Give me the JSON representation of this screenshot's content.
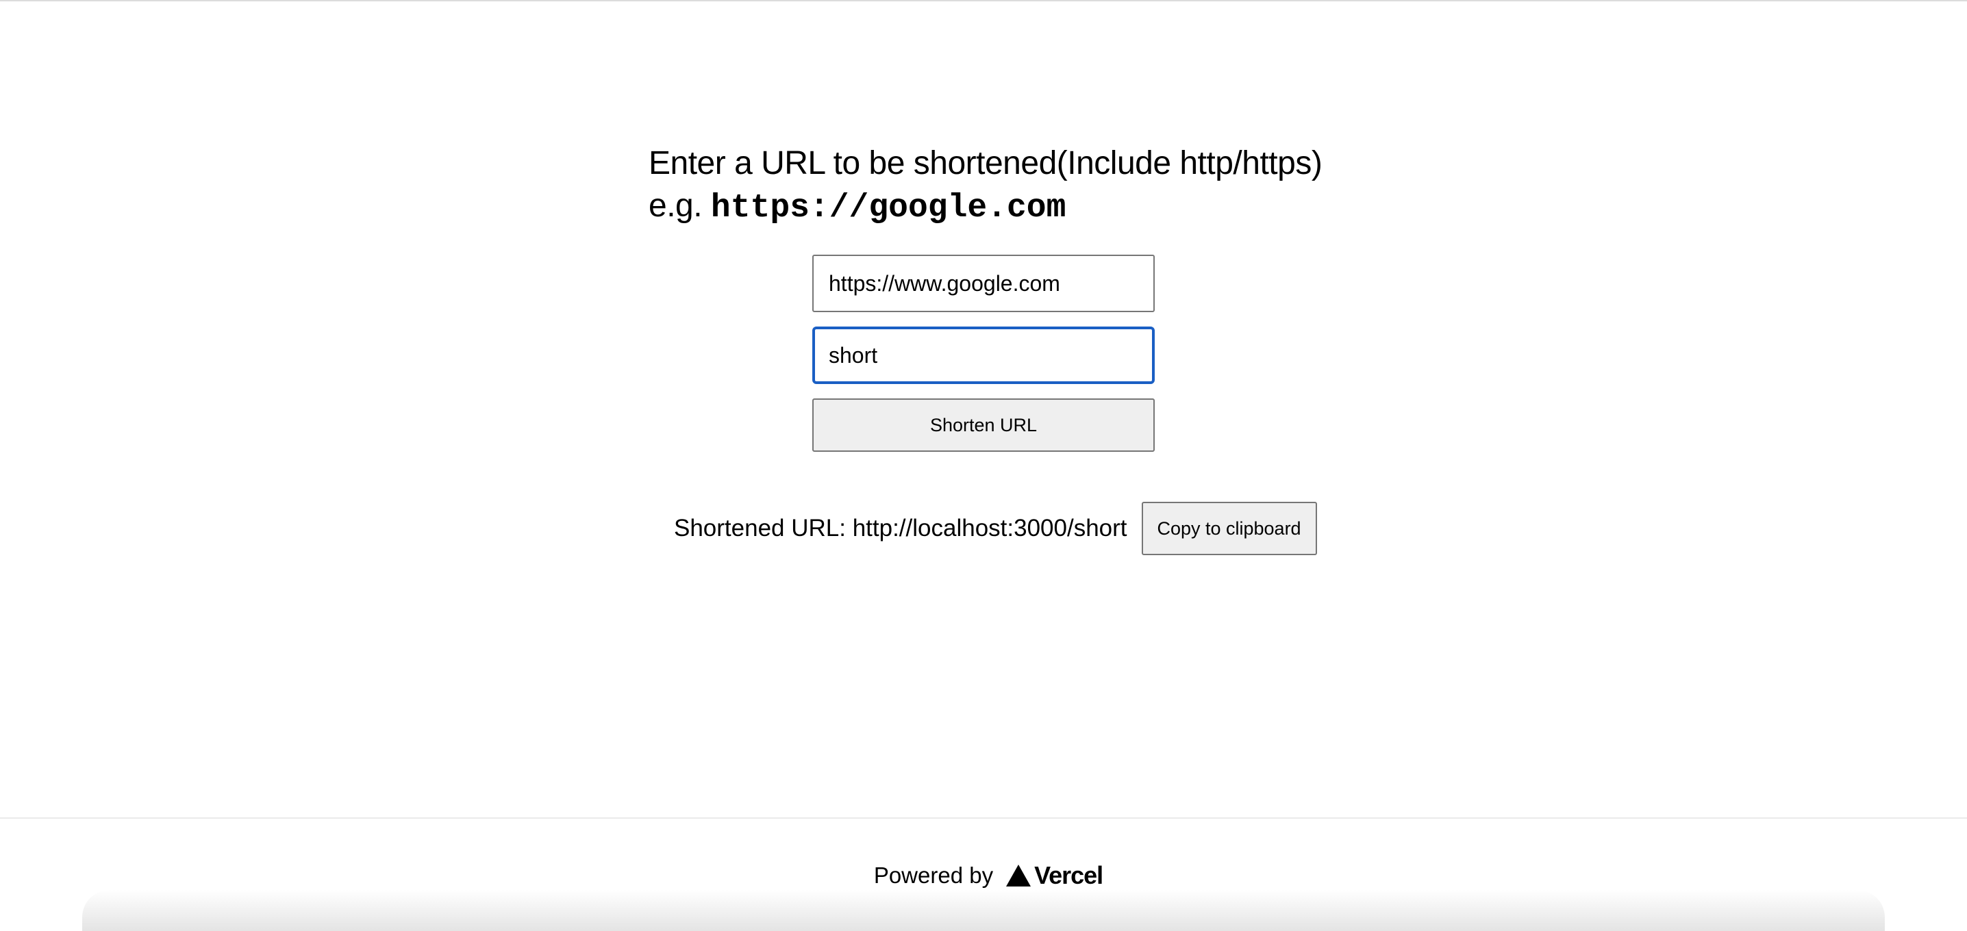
{
  "heading": {
    "line1": "Enter a URL to be shortened(Include http/https)",
    "example_prefix": "e.g. ",
    "example_url": "https://google.com"
  },
  "form": {
    "url_value": "https://www.google.com",
    "alias_value": "short",
    "submit_label": "Shorten URL"
  },
  "result": {
    "text": "Shortened URL: http://localhost:3000/short",
    "copy_label": "Copy to clipboard"
  },
  "footer": {
    "powered_by": "Powered by",
    "brand": "Vercel",
    "brand_icon": "vercel-triangle-icon"
  },
  "colors": {
    "focus_border": "#1a5fc4",
    "button_bg": "#efefef",
    "input_border": "#767676"
  }
}
